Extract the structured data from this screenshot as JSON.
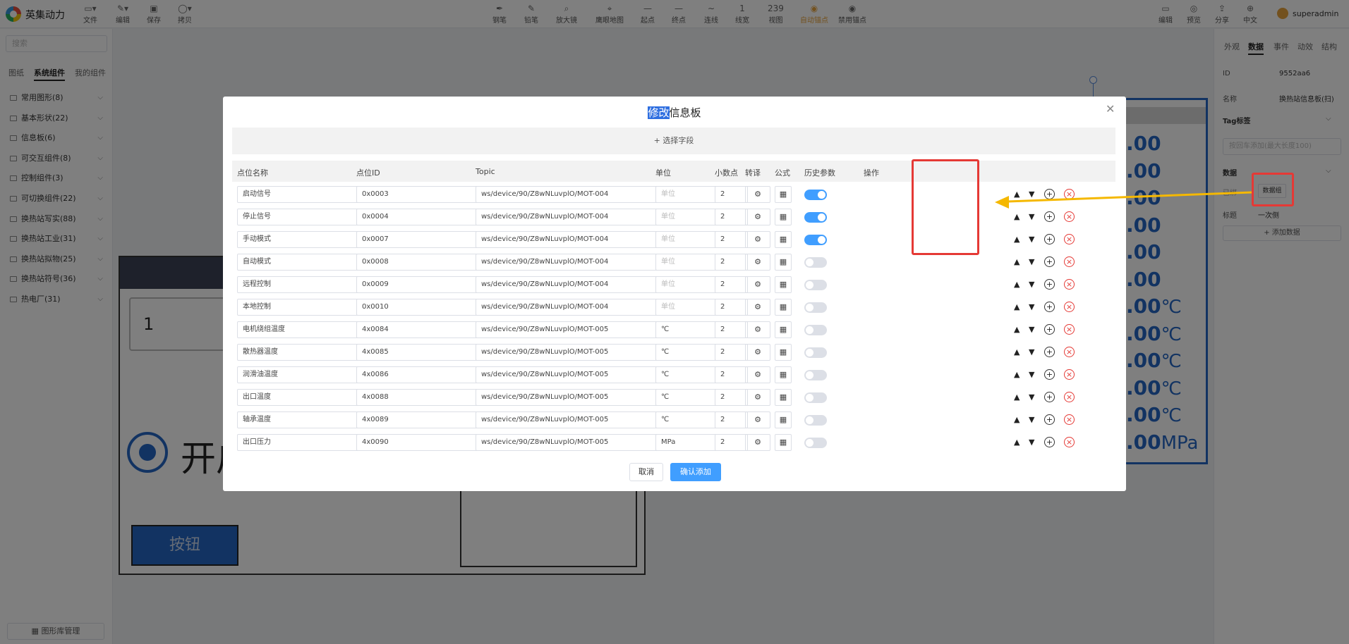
{
  "app": {
    "brand": "英集动力",
    "user": "superadmin"
  },
  "toolbar": {
    "left": [
      "文件",
      "编辑",
      "保存",
      "拷贝"
    ],
    "center": [
      "钢笔",
      "铅笔",
      "放大镜",
      "鹰眼地图",
      "起点",
      "终点",
      "连线",
      "线宽",
      "视图",
      "自动锚点",
      "禁用锚点"
    ],
    "center_values": {
      "line_width": "1",
      "zoom": "239"
    },
    "right": [
      "编辑",
      "预览",
      "分享",
      "中文"
    ],
    "active_item": "自动锚点"
  },
  "sidebar": {
    "search_placeholder": "搜索",
    "tabs": [
      "图纸",
      "系统组件",
      "我的组件"
    ],
    "active_tab": "系统组件",
    "categories": [
      "常用图形(8)",
      "基本形状(22)",
      "信息板(6)",
      "可交互组件(8)",
      "控制组件(3)",
      "可切换组件(22)",
      "换热站写实(88)",
      "换热站工业(31)",
      "换热站拟物(25)",
      "换热站符号(36)",
      "热电厂(31)"
    ],
    "library_button": "图形库管理"
  },
  "right_panel": {
    "tabs": [
      "外观",
      "数据",
      "事件",
      "动效",
      "结构"
    ],
    "active_tab": "数据",
    "id_label": "ID",
    "id_value": "9552aa6",
    "name_label": "名称",
    "name_value": "换热站信息板(扫)",
    "tag_label": "Tag标签",
    "tag_placeholder": "按回车添加(最大长度100)",
    "data_label": "数据",
    "data_group_label": "已绑",
    "data_group_button": "数据组",
    "title_label": "标题",
    "title_value": "一次侧",
    "add_data_button": "添加数据"
  },
  "canvas": {
    "number_box": "1",
    "radio_text": "开启",
    "button_text": "按钮",
    "board_values": [
      ".00",
      ".00",
      ".00",
      ".00",
      ".00",
      ".00",
      ".00",
      ".00",
      ".00",
      ".00",
      ".00",
      ".00"
    ],
    "board_units": [
      "",
      "",
      "",
      "",
      "",
      "",
      "℃",
      "℃",
      "℃",
      "℃",
      "℃",
      "MPa"
    ]
  },
  "dialog": {
    "title_highlight": "修改",
    "title_rest": "信息板",
    "select_fields": "+ 选择字段",
    "columns": [
      "点位名称",
      "点位ID",
      "Topic",
      "单位",
      "小数点",
      "转译",
      "公式",
      "历史参数",
      "操作"
    ],
    "unit_placeholder": "单位",
    "rows": [
      {
        "name": "启动信号",
        "id": "0x0003",
        "topic": "ws/device/90/Z8wNLuvplO/MOT-004",
        "unit": "",
        "decimals": "2",
        "history": true
      },
      {
        "name": "停止信号",
        "id": "0x0004",
        "topic": "ws/device/90/Z8wNLuvplO/MOT-004",
        "unit": "",
        "decimals": "2",
        "history": true
      },
      {
        "name": "手动模式",
        "id": "0x0007",
        "topic": "ws/device/90/Z8wNLuvplO/MOT-004",
        "unit": "",
        "decimals": "2",
        "history": true
      },
      {
        "name": "自动模式",
        "id": "0x0008",
        "topic": "ws/device/90/Z8wNLuvplO/MOT-004",
        "unit": "",
        "decimals": "2",
        "history": false
      },
      {
        "name": "远程控制",
        "id": "0x0009",
        "topic": "ws/device/90/Z8wNLuvplO/MOT-004",
        "unit": "",
        "decimals": "2",
        "history": false
      },
      {
        "name": "本地控制",
        "id": "0x0010",
        "topic": "ws/device/90/Z8wNLuvplO/MOT-004",
        "unit": "",
        "decimals": "2",
        "history": false
      },
      {
        "name": "电机绕组温度",
        "id": "4x0084",
        "topic": "ws/device/90/Z8wNLuvplO/MOT-005",
        "unit": "℃",
        "decimals": "2",
        "history": false
      },
      {
        "name": "散热器温度",
        "id": "4x0085",
        "topic": "ws/device/90/Z8wNLuvplO/MOT-005",
        "unit": "℃",
        "decimals": "2",
        "history": false
      },
      {
        "name": "润滑油温度",
        "id": "4x0086",
        "topic": "ws/device/90/Z8wNLuvplO/MOT-005",
        "unit": "℃",
        "decimals": "2",
        "history": false
      },
      {
        "name": "出口温度",
        "id": "4x0088",
        "topic": "ws/device/90/Z8wNLuvplO/MOT-005",
        "unit": "℃",
        "decimals": "2",
        "history": false
      },
      {
        "name": "轴承温度",
        "id": "4x0089",
        "topic": "ws/device/90/Z8wNLuvplO/MOT-005",
        "unit": "℃",
        "decimals": "2",
        "history": false
      },
      {
        "name": "出口压力",
        "id": "4x0090",
        "topic": "ws/device/90/Z8wNLuvplO/MOT-005",
        "unit": "MPa",
        "decimals": "2",
        "history": false
      }
    ],
    "cancel_button": "取消",
    "confirm_button": "确认添加"
  },
  "colors": {
    "accent": "#409eff",
    "board_blue": "#2566c4",
    "annotation_red": "#e53935",
    "annotation_arrow": "#f5b800"
  }
}
